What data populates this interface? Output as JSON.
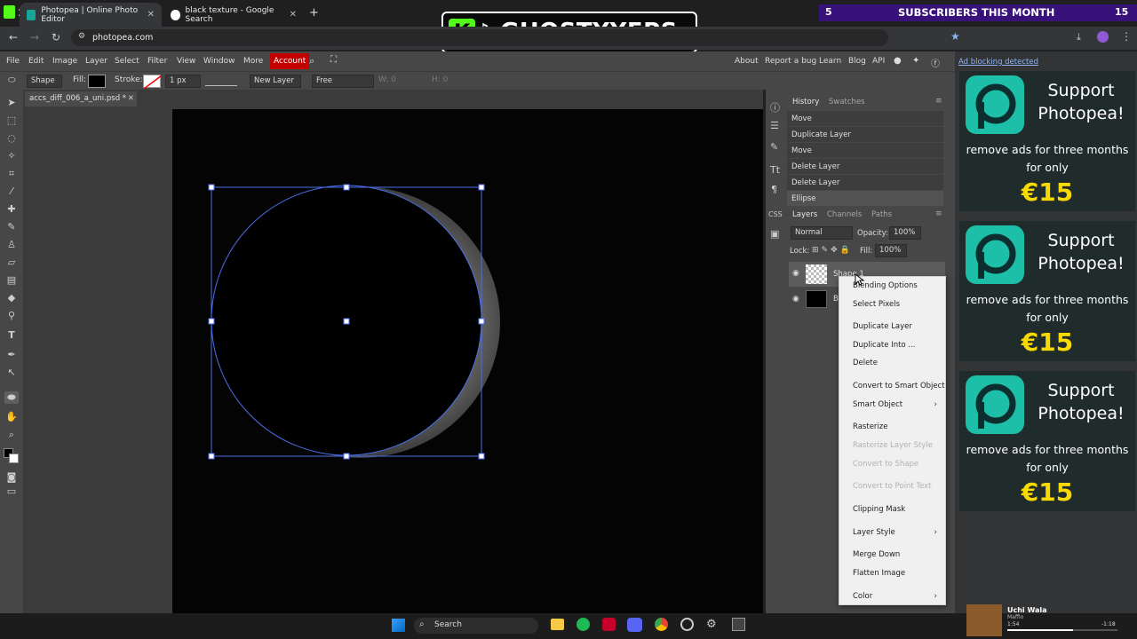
{
  "browser": {
    "tabs": [
      {
        "title": "Photopea | Online Photo Editor",
        "active": true
      },
      {
        "title": "black texture - Google Search",
        "active": false
      }
    ],
    "url": "photopea.com"
  },
  "overlay": {
    "brand": "GHOSTYYFPS",
    "sub_count_left": "5",
    "sub_text": "SUBSCRIBERS THIS MONTH",
    "sub_count_right": "15",
    "tab_counter": "1"
  },
  "menubar": {
    "items": [
      "File",
      "Edit",
      "Image",
      "Layer",
      "Select",
      "Filter",
      "View",
      "Window",
      "More",
      "Account"
    ],
    "right": [
      "About",
      "Report a bug",
      "Learn",
      "Blog",
      "API"
    ]
  },
  "optbar": {
    "tool": "Shape",
    "fill_label": "Fill:",
    "stroke_label": "Stroke:",
    "stroke_width": "1 px",
    "layer_mode": "New Layer",
    "constraint": "Free",
    "w_label": "W: 0",
    "h_label": "H: 0"
  },
  "document": {
    "tab_name": "accs_diff_006_a_uni.psd *"
  },
  "history": {
    "tabs": [
      "History",
      "Swatches"
    ],
    "items": [
      "Move",
      "Duplicate Layer",
      "Move",
      "Delete Layer",
      "Delete Layer",
      "Ellipse"
    ]
  },
  "layers": {
    "tabs": [
      "Layers",
      "Channels",
      "Paths"
    ],
    "blend": "Normal",
    "opacity_label": "Opacity:",
    "opacity": "100%",
    "lock_label": "Lock:",
    "fill_label": "Fill:",
    "fill": "100%",
    "rows": [
      "Shape 1",
      "B"
    ]
  },
  "context_menu": {
    "items": [
      {
        "label": "Blending Options",
        "disabled": false,
        "sub": false
      },
      {
        "label": "Select Pixels",
        "disabled": false,
        "sub": false
      },
      {
        "label": "Duplicate Layer",
        "disabled": false,
        "sub": false
      },
      {
        "label": "Duplicate Into ...",
        "disabled": false,
        "sub": false
      },
      {
        "label": "Delete",
        "disabled": false,
        "sub": false
      },
      {
        "label": "Convert to Smart Object",
        "disabled": false,
        "sub": false
      },
      {
        "label": "Smart Object",
        "disabled": false,
        "sub": true
      },
      {
        "label": "Rasterize",
        "disabled": false,
        "sub": false
      },
      {
        "label": "Rasterize Layer Style",
        "disabled": true,
        "sub": false
      },
      {
        "label": "Convert to Shape",
        "disabled": true,
        "sub": false
      },
      {
        "label": "Convert to Point Text",
        "disabled": true,
        "sub": false
      },
      {
        "label": "Clipping Mask",
        "disabled": false,
        "sub": false
      },
      {
        "label": "Layer Style",
        "disabled": false,
        "sub": true
      },
      {
        "label": "Merge Down",
        "disabled": false,
        "sub": false
      },
      {
        "label": "Flatten Image",
        "disabled": false,
        "sub": false
      },
      {
        "label": "Color",
        "disabled": false,
        "sub": true
      }
    ]
  },
  "ads": {
    "notice": "Ad blocking detected",
    "blocks": [
      {
        "line1": "Support",
        "line2": "Photopea!",
        "line3": "remove ads for three months",
        "line4": "for only",
        "price": "€15"
      },
      {
        "line1": "Support",
        "line2": "Photopea!",
        "line3": "remove ads for three months",
        "line4": "for only",
        "price": "€15"
      },
      {
        "line1": "Support",
        "line2": "Photopea!",
        "line3": "remove ads for three months",
        "line4": "for only",
        "price": "€15"
      }
    ]
  },
  "taskbar": {
    "search": "Search",
    "media_title": "Uchi Wala",
    "media_artist": "Maffio",
    "media_elapsed": "1:54",
    "media_remaining": "-1:18"
  },
  "colors": {
    "accent": "#c20000",
    "selection": "#4a6ee8",
    "ad_price": "#f8da00",
    "ad_logo": "#1dbfa8"
  }
}
